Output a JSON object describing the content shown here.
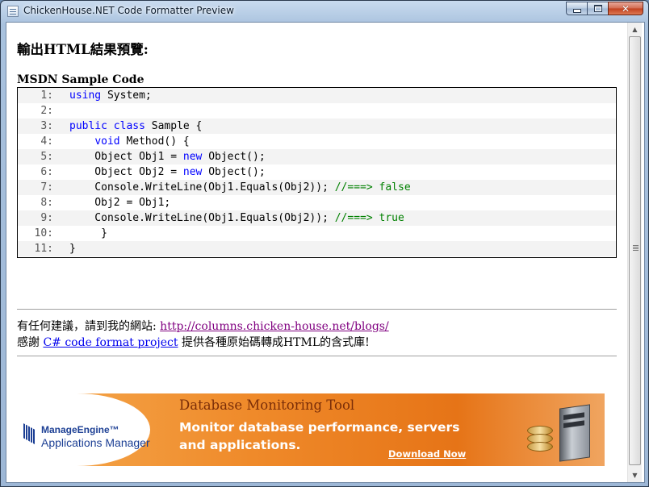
{
  "window": {
    "title": "ChickenHouse.NET Code Formatter Preview",
    "close_glyph": "✕"
  },
  "page": {
    "heading": "輸出HTML結果預覽:",
    "code_caption": "MSDN Sample Code",
    "code_lines": [
      {
        "num": "1:",
        "segments": [
          {
            "t": "using",
            "c": "kw"
          },
          {
            "t": " System;",
            "c": ""
          }
        ]
      },
      {
        "num": "2:",
        "segments": []
      },
      {
        "num": "3:",
        "segments": [
          {
            "t": "public",
            "c": "kw"
          },
          {
            "t": " ",
            "c": ""
          },
          {
            "t": "class",
            "c": "kw"
          },
          {
            "t": " Sample {",
            "c": ""
          }
        ]
      },
      {
        "num": "4:",
        "segments": [
          {
            "t": "    ",
            "c": ""
          },
          {
            "t": "void",
            "c": "kw"
          },
          {
            "t": " Method() {",
            "c": ""
          }
        ]
      },
      {
        "num": "5:",
        "segments": [
          {
            "t": "    Object Obj1 = ",
            "c": ""
          },
          {
            "t": "new",
            "c": "kw"
          },
          {
            "t": " Object();",
            "c": ""
          }
        ]
      },
      {
        "num": "6:",
        "segments": [
          {
            "t": "    Object Obj2 = ",
            "c": ""
          },
          {
            "t": "new",
            "c": "kw"
          },
          {
            "t": " Object();",
            "c": ""
          }
        ]
      },
      {
        "num": "7:",
        "segments": [
          {
            "t": "    Console.WriteLine(Obj1.Equals(Obj2)); ",
            "c": ""
          },
          {
            "t": "//===> false",
            "c": "cm"
          }
        ]
      },
      {
        "num": "8:",
        "segments": [
          {
            "t": "    Obj2 = Obj1;",
            "c": ""
          }
        ]
      },
      {
        "num": "9:",
        "segments": [
          {
            "t": "    Console.WriteLine(Obj1.Equals(Obj2)); ",
            "c": ""
          },
          {
            "t": "//===> true",
            "c": "cm"
          }
        ]
      },
      {
        "num": "10:",
        "segments": [
          {
            "t": "     }",
            "c": ""
          }
        ]
      },
      {
        "num": "11:",
        "segments": [
          {
            "t": "}",
            "c": ""
          }
        ]
      }
    ],
    "info": {
      "suggest_prefix": "有任何建議，請到我的網站: ",
      "site_link": "http://columns.chicken-house.net/blogs/",
      "thanks_prefix": "感謝 ",
      "project_link": "C# code format project",
      "thanks_suffix": " 提供各種原始碼轉成HTML的含式庫!"
    },
    "ad": {
      "brand": "ManageEngine™",
      "product": "Applications Manager",
      "title": "Database Monitoring Tool",
      "subtitle": "Monitor database performance, servers and applications.",
      "cta": "Download Now"
    }
  },
  "icons": {
    "app": "window-app-icon",
    "minimize": "minimize-icon",
    "maximize": "maximize-icon",
    "close": "close-icon",
    "scroll_up": "▲",
    "scroll_down": "▼"
  },
  "colors": {
    "keyword": "#0000ff",
    "comment": "#008000",
    "visited_link": "#800080",
    "link": "#0000ee",
    "ad_orange": "#ef8a2a"
  }
}
